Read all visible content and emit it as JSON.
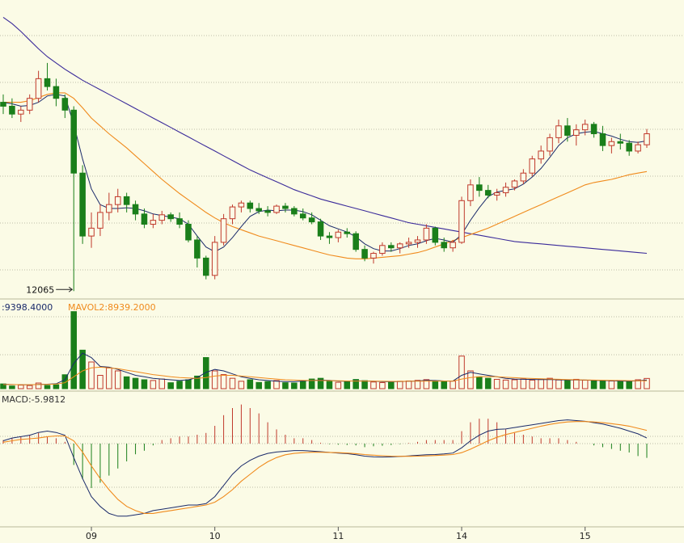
{
  "colors": {
    "background": "#fbfbe6",
    "up": "#c0392b",
    "down": "#1a7f1a",
    "ma_long": "#3a2a9a",
    "ma_mid": "#f08a1c",
    "ma_short": "#1a2a6a",
    "grid": "#bdbda8"
  },
  "chart_data": [
    {
      "type": "candlestick",
      "x_ticks": [
        "09",
        "10",
        "11",
        "14",
        "15"
      ],
      "annotation": "12065",
      "candles": [
        [
          12290,
          12300,
          12275,
          12285
        ],
        [
          12285,
          12295,
          12270,
          12275
        ],
        [
          12275,
          12285,
          12265,
          12280
        ],
        [
          12280,
          12300,
          12275,
          12295
        ],
        [
          12295,
          12330,
          12290,
          12320
        ],
        [
          12320,
          12340,
          12305,
          12310
        ],
        [
          12310,
          12320,
          12285,
          12295
        ],
        [
          12295,
          12300,
          12270,
          12280
        ],
        [
          12280,
          12285,
          12050,
          12200
        ],
        [
          12200,
          12210,
          12110,
          12120
        ],
        [
          12120,
          12150,
          12105,
          12130
        ],
        [
          12130,
          12160,
          12120,
          12150
        ],
        [
          12150,
          12175,
          12140,
          12160
        ],
        [
          12160,
          12180,
          12150,
          12170
        ],
        [
          12170,
          12175,
          12150,
          12160
        ],
        [
          12160,
          12165,
          12140,
          12148
        ],
        [
          12148,
          12155,
          12130,
          12135
        ],
        [
          12135,
          12148,
          12130,
          12140
        ],
        [
          12140,
          12152,
          12135,
          12147
        ],
        [
          12147,
          12150,
          12138,
          12142
        ],
        [
          12142,
          12150,
          12130,
          12135
        ],
        [
          12135,
          12140,
          12112,
          12115
        ],
        [
          12115,
          12120,
          12080,
          12092
        ],
        [
          12092,
          12095,
          12065,
          12070
        ],
        [
          12070,
          12120,
          12065,
          12112
        ],
        [
          12112,
          12148,
          12108,
          12142
        ],
        [
          12142,
          12160,
          12135,
          12157
        ],
        [
          12157,
          12165,
          12150,
          12162
        ],
        [
          12162,
          12165,
          12150,
          12155
        ],
        [
          12155,
          12162,
          12148,
          12152
        ],
        [
          12152,
          12158,
          12145,
          12150
        ],
        [
          12150,
          12160,
          12148,
          12158
        ],
        [
          12158,
          12162,
          12150,
          12155
        ],
        [
          12155,
          12158,
          12145,
          12148
        ],
        [
          12148,
          12155,
          12140,
          12143
        ],
        [
          12143,
          12150,
          12135,
          12138
        ],
        [
          12138,
          12142,
          12115,
          12120
        ],
        [
          12120,
          12125,
          12110,
          12118
        ],
        [
          12118,
          12128,
          12112,
          12125
        ],
        [
          12125,
          12130,
          12118,
          12123
        ],
        [
          12123,
          12126,
          12100,
          12103
        ],
        [
          12103,
          12108,
          12088,
          12092
        ],
        [
          12092,
          12100,
          12085,
          12098
        ],
        [
          12098,
          12112,
          12095,
          12108
        ],
        [
          12108,
          12112,
          12100,
          12105
        ],
        [
          12105,
          12112,
          12098,
          12110
        ],
        [
          12110,
          12118,
          12105,
          12112
        ],
        [
          12112,
          12120,
          12105,
          12115
        ],
        [
          12115,
          12135,
          12110,
          12130
        ],
        [
          12130,
          12132,
          12108,
          12112
        ],
        [
          12112,
          12118,
          12100,
          12105
        ],
        [
          12105,
          12115,
          12100,
          12112
        ],
        [
          12112,
          12170,
          12110,
          12165
        ],
        [
          12165,
          12192,
          12158,
          12185
        ],
        [
          12185,
          12195,
          12170,
          12178
        ],
        [
          12178,
          12185,
          12168,
          12172
        ],
        [
          12172,
          12180,
          12165,
          12175
        ],
        [
          12175,
          12188,
          12170,
          12182
        ],
        [
          12182,
          12192,
          12178,
          12190
        ],
        [
          12190,
          12205,
          12186,
          12200
        ],
        [
          12200,
          12222,
          12196,
          12218
        ],
        [
          12218,
          12235,
          12212,
          12228
        ],
        [
          12228,
          12250,
          12222,
          12245
        ],
        [
          12245,
          12268,
          12238,
          12260
        ],
        [
          12260,
          12270,
          12240,
          12248
        ],
        [
          12248,
          12262,
          12235,
          12255
        ],
        [
          12255,
          12268,
          12248,
          12262
        ],
        [
          12262,
          12265,
          12245,
          12250
        ],
        [
          12250,
          12260,
          12228,
          12235
        ],
        [
          12235,
          12245,
          12225,
          12240
        ],
        [
          12240,
          12250,
          12230,
          12238
        ],
        [
          12238,
          12242,
          12222,
          12228
        ],
        [
          12228,
          12240,
          12225,
          12236
        ],
        [
          12236,
          12256,
          12232,
          12250
        ]
      ],
      "ma_lines": {
        "long": [
          12398,
          12390,
          12380,
          12369,
          12358,
          12348,
          12340,
          12332,
          12325,
          12318,
          12312,
          12306,
          12300,
          12294,
          12288,
          12282,
          12276,
          12270,
          12264,
          12258,
          12252,
          12246,
          12240,
          12234,
          12228,
          12222,
          12216,
          12210,
          12204,
          12199,
          12194,
          12189,
          12184,
          12179,
          12175,
          12171,
          12167,
          12164,
          12161,
          12158,
          12155,
          12152,
          12149,
          12146,
          12143,
          12140,
          12137,
          12135,
          12133,
          12131,
          12129,
          12127,
          12125,
          12123,
          12121,
          12119,
          12117,
          12115,
          12113,
          12112,
          12111,
          12110,
          12109,
          12108,
          12107,
          12106,
          12105,
          12104,
          12103,
          12102,
          12101,
          12100,
          12099,
          12098,
          12097,
          12096,
          12095,
          12094,
          12093,
          12092
        ],
        "mid": [
          12290,
          12290,
          12290,
          12292,
          12296,
          12300,
          12302,
          12302,
          12295,
          12283,
          12270,
          12260,
          12250,
          12241,
          12232,
          12222,
          12212,
          12202,
          12192,
          12183,
          12174,
          12166,
          12158,
          12150,
          12143,
          12137,
          12132,
          12128,
          12124,
          12120,
          12117,
          12114,
          12111,
          12108,
          12105,
          12102,
          12099,
          12096,
          12094,
          12092,
          12091,
          12091,
          12092,
          12093,
          12094,
          12095,
          12097,
          12099,
          12102,
          12106,
          12110,
          12114,
          12118,
          12122,
          12126,
          12130,
          12135,
          12140,
          12145,
          12150,
          12155,
          12160,
          12165,
          12170,
          12175,
          12180,
          12185,
          12188,
          12190,
          12192,
          12195,
          12198,
          12200,
          12202
        ],
        "short": [
          12290,
          12288,
          12285,
          12286,
          12290,
          12298,
          12300,
          12298,
          12262,
          12218,
          12180,
          12160,
          12155,
          12155,
          12156,
          12155,
          12152,
          12148,
          12146,
          12144,
          12142,
          12135,
          12120,
          12106,
          12100,
          12106,
          12118,
          12132,
          12145,
          12151,
          12153,
          12152,
          12153,
          12153,
          12151,
          12147,
          12140,
          12133,
          12129,
          12125,
          12119,
          12110,
          12104,
          12101,
          12101,
          12104,
          12108,
          12110,
          12114,
          12117,
          12115,
          12112,
          12122,
          12140,
          12156,
          12170,
          12176,
          12178,
          12180,
          12186,
          12195,
          12206,
          12220,
          12235,
          12245,
          12250,
          12252,
          12253,
          12250,
          12247,
          12243,
          12240,
          12239,
          12241
        ]
      }
    },
    {
      "type": "bar",
      "name": "volume",
      "label_value": ":9398.4000",
      "ma2_label": "MAVOL2:8939.2000",
      "values": [
        3200,
        1800,
        2400,
        2100,
        3800,
        2200,
        2600,
        9400,
        52000,
        26000,
        18000,
        9000,
        14000,
        12000,
        8000,
        7000,
        6000,
        5500,
        6500,
        4000,
        5000,
        6000,
        8500,
        21000,
        12000,
        9500,
        7000,
        5000,
        6000,
        4200,
        4800,
        5500,
        4000,
        3800,
        5000,
        6500,
        7000,
        5200,
        4300,
        4600,
        6200,
        5400,
        4500,
        4100,
        4700,
        5000,
        5200,
        5600,
        6100,
        5200,
        4900,
        5100,
        22000,
        12000,
        8000,
        7000,
        6300,
        5800,
        6000,
        6500,
        5800,
        6200,
        7000,
        5900,
        5600,
        6300,
        5700,
        5400,
        5500,
        5200,
        5000,
        4800,
        6000,
        6900
      ],
      "ma_a": [
        3000,
        2800,
        2700,
        2600,
        2900,
        3000,
        3300,
        6000,
        17000,
        24000,
        21000,
        15000,
        14500,
        13000,
        11000,
        9000,
        8000,
        7000,
        6500,
        6000,
        5500,
        6000,
        7500,
        11000,
        13000,
        12000,
        10000,
        8000,
        7000,
        6000,
        5500,
        5000,
        4800,
        4700,
        5200,
        5600,
        5800,
        5600,
        5100,
        5000,
        5300,
        5200,
        5000,
        4800,
        4700,
        4800,
        5000,
        5200,
        5600,
        5500,
        5200,
        5100,
        9000,
        11000,
        10000,
        9000,
        8000,
        7000,
        6500,
        6300,
        6200,
        6100,
        6200,
        6000,
        5900,
        5900,
        5800,
        5600,
        5500,
        5300,
        5200,
        5000,
        5300,
        5900
      ],
      "ma_b": [
        2800,
        2800,
        2700,
        2700,
        2800,
        2900,
        3100,
        4000,
        8000,
        12000,
        14000,
        14500,
        14000,
        13500,
        12500,
        11500,
        10500,
        9500,
        8800,
        8000,
        7500,
        7200,
        7000,
        7500,
        8500,
        9000,
        9000,
        8500,
        8000,
        7500,
        7000,
        6500,
        6000,
        5800,
        5600,
        5500,
        5500,
        5400,
        5300,
        5200,
        5100,
        5100,
        5000,
        5000,
        4900,
        4900,
        5000,
        5000,
        5100,
        5100,
        5100,
        5100,
        6500,
        7500,
        8000,
        8200,
        8000,
        7700,
        7400,
        7100,
        6900,
        6700,
        6500,
        6300,
        6100,
        6000,
        5900,
        5800,
        5700,
        5600,
        5500,
        5400,
        5300,
        5300
      ]
    },
    {
      "type": "macd",
      "label": "MACD:-5.9812",
      "dif": [
        2,
        4,
        5,
        6,
        8,
        9,
        8,
        6,
        -10,
        -25,
        -38,
        -45,
        -50,
        -52,
        -52,
        -51,
        -50,
        -48,
        -47,
        -46,
        -45,
        -44,
        -44,
        -43,
        -38,
        -30,
        -22,
        -16,
        -12,
        -9,
        -7,
        -6,
        -5.5,
        -5,
        -5,
        -5.3,
        -5.8,
        -6.3,
        -6.8,
        -7.2,
        -8,
        -9,
        -9.5,
        -9.6,
        -9.5,
        -9.2,
        -8.8,
        -8.4,
        -8,
        -7.8,
        -7.4,
        -6.8,
        -3,
        2,
        6,
        9,
        10.2,
        10.5,
        11.5,
        12.5,
        13.5,
        14.5,
        15.5,
        16.5,
        17,
        16.5,
        16,
        15,
        14,
        12.5,
        11,
        9,
        7,
        4
      ],
      "dea": [
        1,
        2,
        3,
        3.5,
        4,
        5,
        5.5,
        5.5,
        2,
        -6,
        -16,
        -25,
        -33,
        -40,
        -45,
        -48,
        -50,
        -50,
        -49,
        -48,
        -47,
        -46,
        -45,
        -44,
        -42,
        -38,
        -33,
        -27,
        -22,
        -17,
        -13,
        -10,
        -8,
        -7,
        -6.5,
        -6.2,
        -6.2,
        -6.3,
        -6.5,
        -6.8,
        -7.2,
        -7.8,
        -8.3,
        -8.7,
        -9,
        -9.1,
        -9.1,
        -9,
        -8.8,
        -8.5,
        -8.2,
        -7.8,
        -6.5,
        -4,
        -1,
        2,
        4.5,
        6.5,
        8,
        9.5,
        11,
        12.5,
        13.8,
        14.8,
        15.5,
        15.8,
        15.8,
        15.5,
        15,
        14.3,
        13.5,
        12.5,
        11,
        9.5
      ],
      "hist": [
        2,
        3,
        4,
        5,
        6,
        4,
        3,
        1,
        -12,
        -20,
        -25,
        -22,
        -18,
        -14,
        -10,
        -6,
        -4,
        -1,
        2,
        3,
        4,
        4,
        5,
        6,
        10,
        16,
        20,
        22,
        20,
        17,
        12,
        8,
        5,
        3,
        3,
        2,
        0.5,
        -0.3,
        -0.6,
        -0.8,
        -1,
        -2,
        -1.5,
        -1.2,
        -0.8,
        -0.3,
        0.3,
        1,
        2,
        2,
        2,
        2,
        7,
        12,
        14,
        14,
        12,
        8,
        6,
        5,
        4,
        3,
        3,
        3,
        2,
        1,
        0,
        -1,
        -2,
        -3,
        -4,
        -5,
        -7,
        -8
      ]
    }
  ]
}
